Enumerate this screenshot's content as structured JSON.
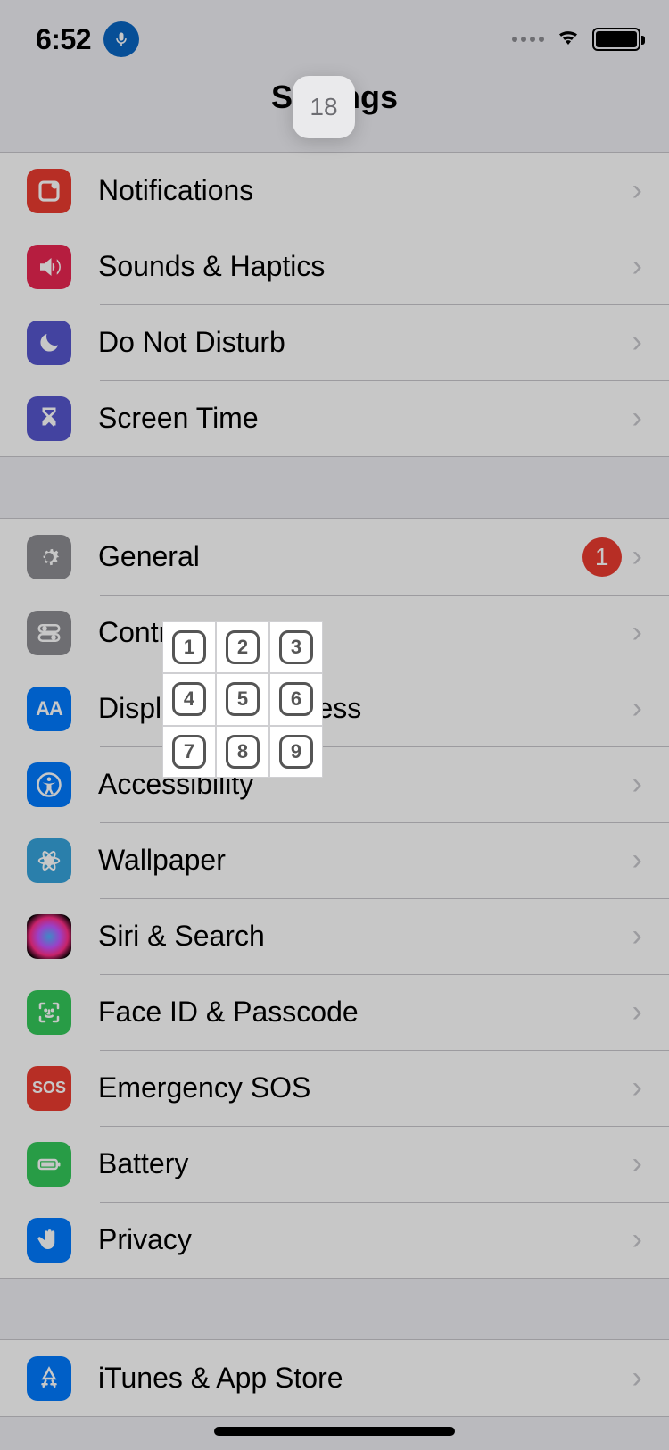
{
  "status": {
    "time": "6:52",
    "mic_active": true
  },
  "page_title": "Settings",
  "vc_badge": "18",
  "groups": [
    {
      "rows": [
        {
          "icon": "notifications-icon",
          "label": "Notifications"
        },
        {
          "icon": "speaker-icon",
          "label": "Sounds & Haptics"
        },
        {
          "icon": "moon-icon",
          "label": "Do Not Disturb"
        },
        {
          "icon": "hourglass-icon",
          "label": "Screen Time"
        }
      ]
    },
    {
      "rows": [
        {
          "icon": "gear-icon",
          "label": "General",
          "badge": "1"
        },
        {
          "icon": "switches-icon",
          "label": "Control Center"
        },
        {
          "icon": "text-size-icon",
          "label": "Display & Brightness"
        },
        {
          "icon": "accessibility-icon",
          "label": "Accessibility"
        },
        {
          "icon": "flower-icon",
          "label": "Wallpaper"
        },
        {
          "icon": "siri-icon",
          "label": "Siri & Search"
        },
        {
          "icon": "faceid-icon",
          "label": "Face ID & Passcode"
        },
        {
          "icon": "sos-icon",
          "label": "Emergency SOS",
          "icon_text": "SOS"
        },
        {
          "icon": "battery-icon",
          "label": "Battery"
        },
        {
          "icon": "hand-icon",
          "label": "Privacy"
        }
      ]
    },
    {
      "rows": [
        {
          "icon": "appstore-icon",
          "label": "iTunes & App Store"
        }
      ]
    }
  ],
  "vc_grid_numbers": [
    "1",
    "2",
    "3",
    "4",
    "5",
    "6",
    "7",
    "8",
    "9"
  ]
}
